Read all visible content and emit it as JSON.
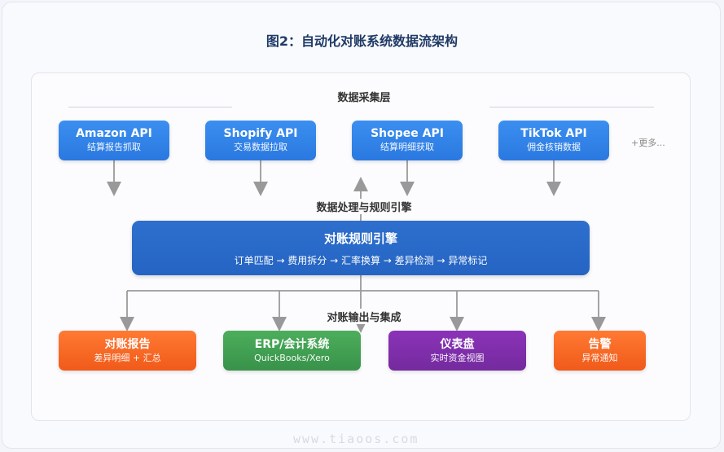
{
  "title": "图2：自动化对账系统数据流架构",
  "layers": {
    "collection": "数据采集层",
    "processing": "数据处理与规则引擎",
    "output": "对账输出与集成"
  },
  "sources": [
    {
      "title": "Amazon API",
      "sub": "结算报告抓取"
    },
    {
      "title": "Shopify API",
      "sub": "交易数据拉取"
    },
    {
      "title": "Shopee API",
      "sub": "结算明细获取"
    },
    {
      "title": "TikTok API",
      "sub": "佣金核销数据"
    }
  ],
  "more": "+更多...",
  "engine": {
    "title": "对账规则引擎",
    "steps": "订单匹配 → 费用拆分 → 汇率换算 → 差异检测 → 异常标记"
  },
  "outputs": [
    {
      "title": "对账报告",
      "sub": "差异明细 + 汇总",
      "color": "#f26522"
    },
    {
      "title": "ERP/会计系统",
      "sub": "QuickBooks/Xero",
      "color": "#43a356"
    },
    {
      "title": "仪表盘",
      "sub": "实时资金视图",
      "color": "#7f2fae"
    },
    {
      "title": "告警",
      "sub": "异常通知",
      "color": "#f26522"
    }
  ],
  "colors": {
    "source_blue": "#2f86ea",
    "engine_blue": "#2a6ac8",
    "arrow": "#999999"
  },
  "watermark": "www.tiaoos.com"
}
